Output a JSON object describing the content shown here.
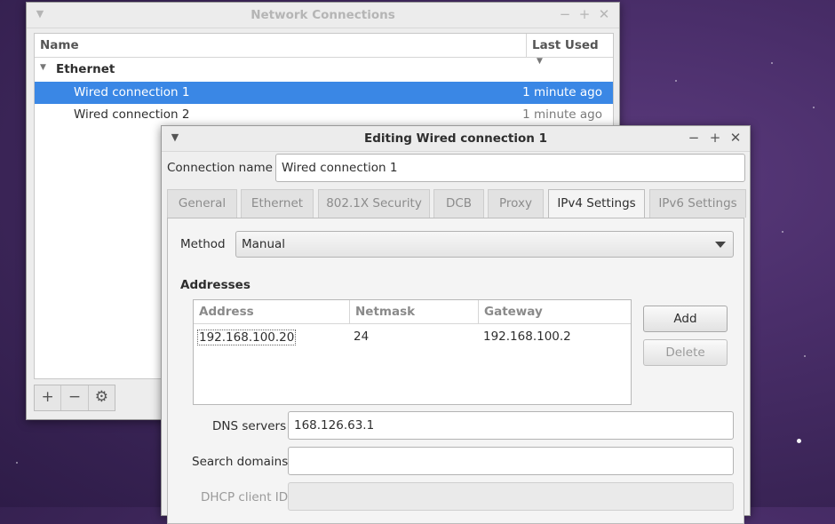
{
  "network_connections": {
    "title": "Network Connections",
    "columns": {
      "name": "Name",
      "last_used": "Last Used"
    },
    "group": "Ethernet",
    "connections": [
      {
        "name": "Wired connection 1",
        "last_used": "1 minute ago"
      },
      {
        "name": "Wired connection 2",
        "last_used": "1 minute ago"
      }
    ],
    "toolbar": {
      "add": "+",
      "remove": "−",
      "settings": "⚙"
    }
  },
  "editor": {
    "title": "Editing Wired connection 1",
    "connection_name_label": "Connection name",
    "connection_name_value": "Wired connection 1",
    "tabs": [
      "General",
      "Ethernet",
      "802.1X Security",
      "DCB",
      "Proxy",
      "IPv4 Settings",
      "IPv6 Settings"
    ],
    "active_tab": "IPv4 Settings",
    "method_label": "Method",
    "method_value": "Manual",
    "addresses_label": "Addresses",
    "address_columns": [
      "Address",
      "Netmask",
      "Gateway"
    ],
    "address_rows": [
      {
        "address": "192.168.100.20",
        "netmask": "24",
        "gateway": "192.168.100.2"
      }
    ],
    "add_label": "Add",
    "delete_label": "Delete",
    "dns_label": "DNS servers",
    "dns_value": "168.126.63.1",
    "search_domains_label": "Search domains",
    "search_domains_value": "",
    "dhcp_client_id_label": "DHCP client ID",
    "dhcp_client_id_value": ""
  },
  "colors": {
    "selection": "#3a87e5",
    "desktop": "#4a2e6a"
  }
}
